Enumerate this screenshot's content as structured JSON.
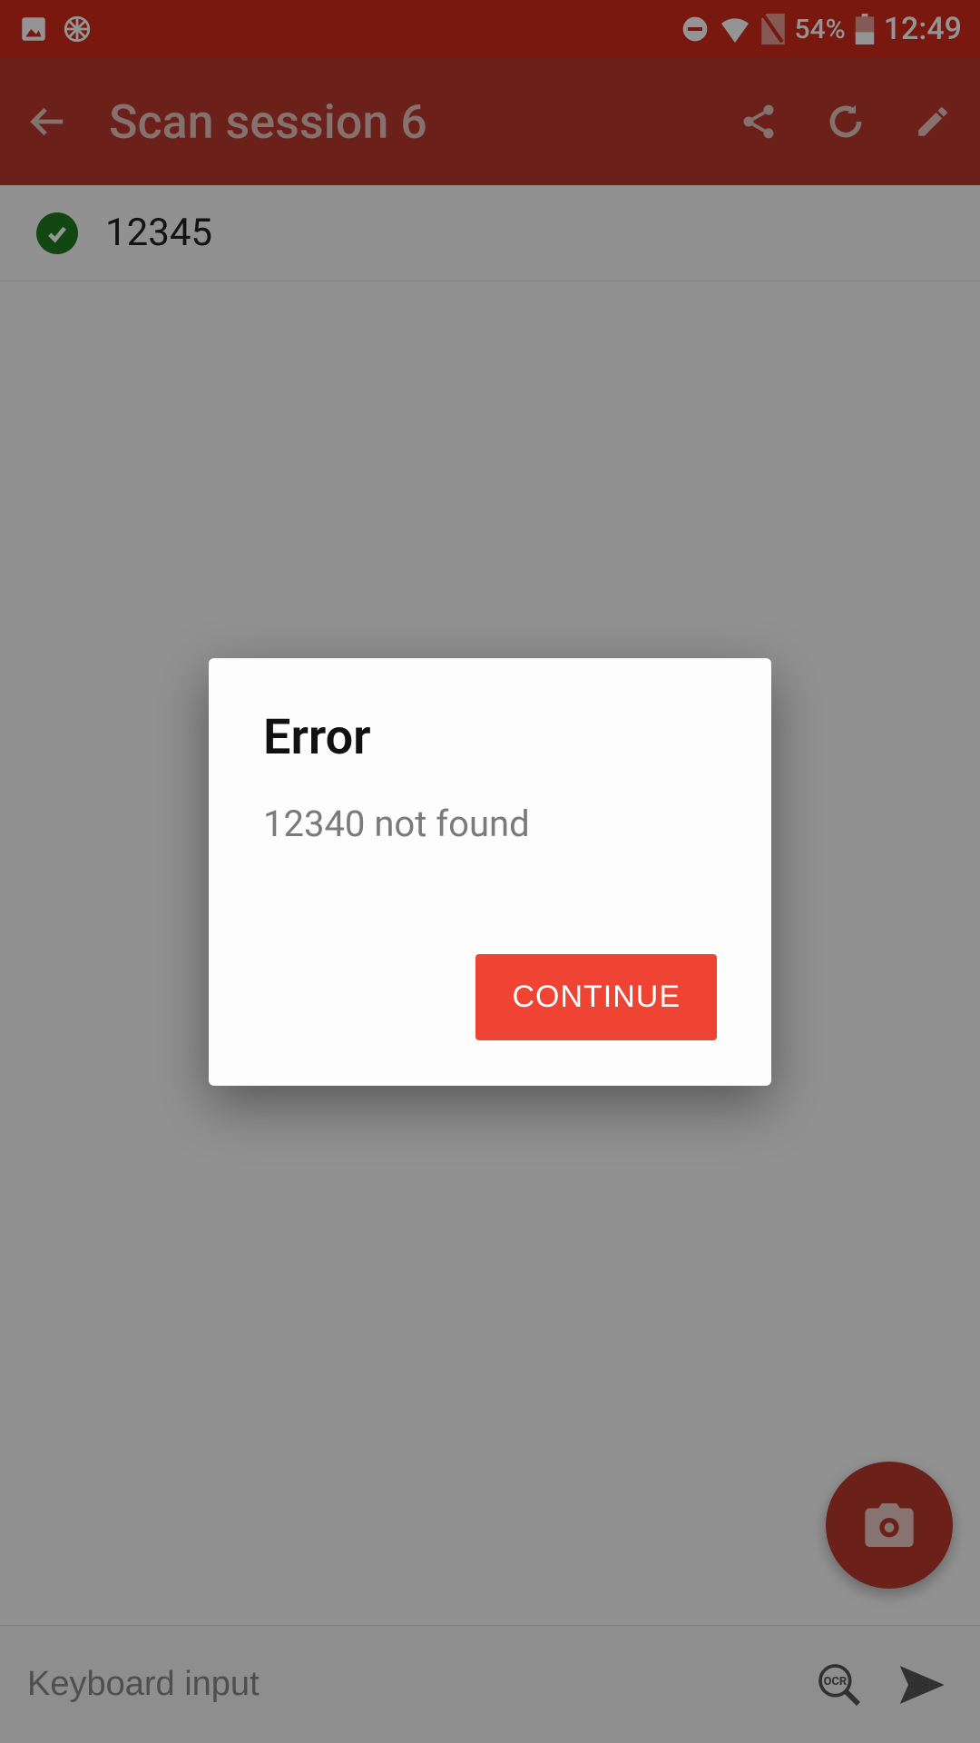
{
  "status": {
    "battery_pct": "54%",
    "clock": "12:49"
  },
  "appbar": {
    "title": "Scan session 6"
  },
  "list": {
    "items": [
      {
        "value": "12345"
      }
    ]
  },
  "input": {
    "placeholder": "Keyboard input",
    "value": ""
  },
  "dialog": {
    "title": "Error",
    "message": "12340 not found",
    "continue_label": "CONTINUE"
  },
  "colors": {
    "primary": "#cf2a1b",
    "primary_dark": "#b9382c",
    "accent": "#ef4434"
  }
}
